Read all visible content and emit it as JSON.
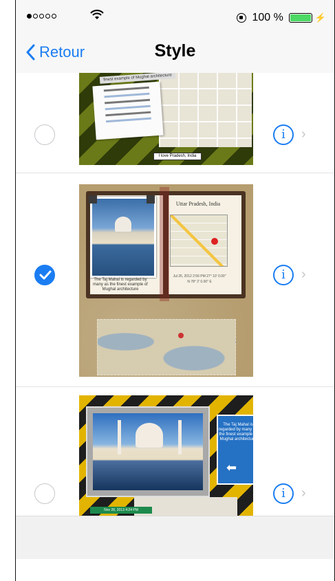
{
  "status_bar": {
    "battery_text": "100 %",
    "carrier_signal": "●oooo"
  },
  "nav": {
    "back_label": "Retour",
    "title": "Style"
  },
  "styles": [
    {
      "selected": false,
      "thumb_label": "I love Pradesh, India",
      "sign_text": "finest example of Mughal architecture"
    },
    {
      "selected": true,
      "page_title": "Uttar Pradesh, India",
      "caption": "The Taj Mahal is regarded by many as the finest example of Mughal architecture",
      "coords": "Jul 26, 2012 2:56 PM 27° 10' 0.00\" N 78° 2' 0.00\" E"
    },
    {
      "selected": false,
      "blue_text": "The Taj Mahal is regarded by many as the finest example of Mughal architecture",
      "date_text": "Nov 28, 2013 4:24 PM"
    }
  ],
  "colors": {
    "accent": "#1b7df2",
    "navbar_bg": "#f7f7f7"
  },
  "icons": {
    "info": "info-icon",
    "chevron": "chevron-right-icon",
    "back": "chevron-left-icon"
  }
}
